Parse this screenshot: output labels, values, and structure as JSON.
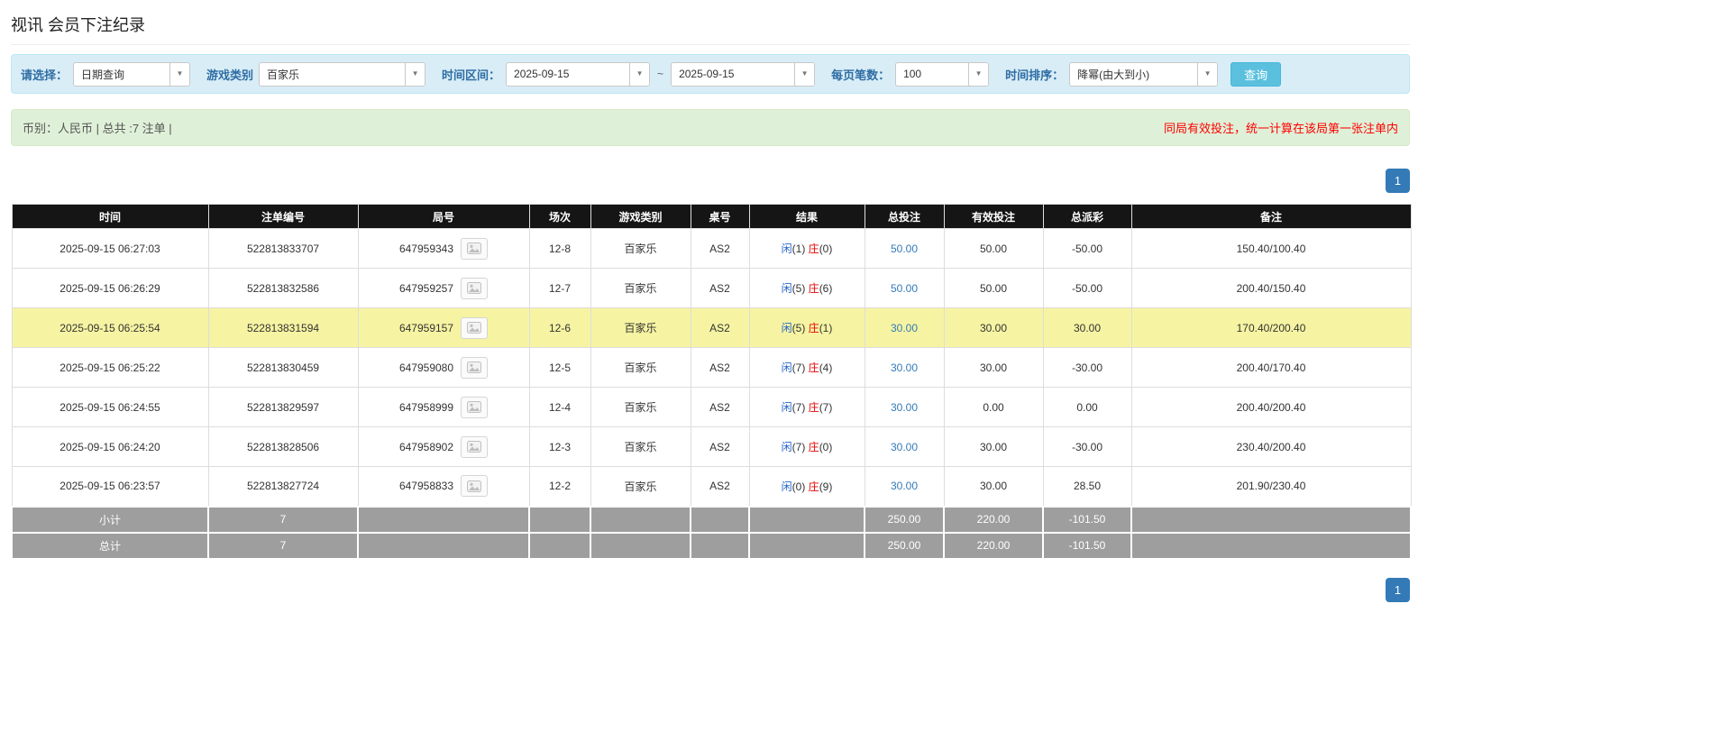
{
  "page": {
    "title": "视讯 会员下注纪录"
  },
  "colors": {
    "filter_bg": "#d9edf7",
    "filter_border": "#bce8f1",
    "filter_label": "#2e6da4",
    "search_button_bg": "#5bc0de",
    "summary_bg": "#dff0d8",
    "summary_border": "#d6e9c6",
    "warning_red": "#ff0000",
    "header_bg": "#151515",
    "highlight_row": "#f6f4a2",
    "link_blue": "#337ab7",
    "negative_red": "#f00000",
    "player_blue": "#2563c9",
    "banker_red": "#e60000",
    "pager_blue": "#337ab7",
    "footer_bg": "#9e9e9e",
    "footer_negative": "#c00000"
  },
  "filters": {
    "select_label": "请选择：",
    "select_value": "日期查询",
    "game_type_label": "游戏类别",
    "game_type_value": "百家乐",
    "date_range_label": "时间区间：",
    "date_from": "2025-09-15",
    "range_separator": "~",
    "date_to": "2025-09-15",
    "page_size_label": "每页笔数：",
    "page_size_value": "100",
    "sort_label": "时间排序：",
    "sort_value": "降幂(由大到小)",
    "search_button": "查询"
  },
  "summary": {
    "left": "币别：人民币 | 总共 :7 注单 |",
    "note": "同局有效投注，统一计算在该局第一张注单内"
  },
  "pagination": {
    "page": "1"
  },
  "table": {
    "headers": [
      "时间",
      "注单编号",
      "局号",
      "场次",
      "游戏类别",
      "桌号",
      "结果",
      "总投注",
      "有效投注",
      "总派彩",
      "备注"
    ],
    "rows": [
      {
        "time": "2025-09-15 06:27:03",
        "bet_id": "522813833707",
        "round_id": "647959343",
        "session": "12-8",
        "game_type": "百家乐",
        "table_no": "AS2",
        "player": "闲",
        "player_score": "(1)",
        "banker": "庄",
        "banker_score": "(0)",
        "total_bet": "50.00",
        "valid_bet": "50.00",
        "payout": "-50.00",
        "note": "150.40/100.40",
        "highlight": false
      },
      {
        "time": "2025-09-15 06:26:29",
        "bet_id": "522813832586",
        "round_id": "647959257",
        "session": "12-7",
        "game_type": "百家乐",
        "table_no": "AS2",
        "player": "闲",
        "player_score": "(5)",
        "banker": "庄",
        "banker_score": "(6)",
        "total_bet": "50.00",
        "valid_bet": "50.00",
        "payout": "-50.00",
        "note": "200.40/150.40",
        "highlight": false
      },
      {
        "time": "2025-09-15 06:25:54",
        "bet_id": "522813831594",
        "round_id": "647959157",
        "session": "12-6",
        "game_type": "百家乐",
        "table_no": "AS2",
        "player": "闲",
        "player_score": "(5)",
        "banker": "庄",
        "banker_score": "(1)",
        "total_bet": "30.00",
        "valid_bet": "30.00",
        "payout": "30.00",
        "note": "170.40/200.40",
        "highlight": true
      },
      {
        "time": "2025-09-15 06:25:22",
        "bet_id": "522813830459",
        "round_id": "647959080",
        "session": "12-5",
        "game_type": "百家乐",
        "table_no": "AS2",
        "player": "闲",
        "player_score": "(7)",
        "banker": "庄",
        "banker_score": "(4)",
        "total_bet": "30.00",
        "valid_bet": "30.00",
        "payout": "-30.00",
        "note": "200.40/170.40",
        "highlight": false
      },
      {
        "time": "2025-09-15 06:24:55",
        "bet_id": "522813829597",
        "round_id": "647958999",
        "session": "12-4",
        "game_type": "百家乐",
        "table_no": "AS2",
        "player": "闲",
        "player_score": "(7)",
        "banker": "庄",
        "banker_score": "(7)",
        "total_bet": "30.00",
        "valid_bet": "0.00",
        "payout": "0.00",
        "note": "200.40/200.40",
        "highlight": false
      },
      {
        "time": "2025-09-15 06:24:20",
        "bet_id": "522813828506",
        "round_id": "647958902",
        "session": "12-3",
        "game_type": "百家乐",
        "table_no": "AS2",
        "player": "闲",
        "player_score": "(7)",
        "banker": "庄",
        "banker_score": "(0)",
        "total_bet": "30.00",
        "valid_bet": "30.00",
        "payout": "-30.00",
        "note": "230.40/200.40",
        "highlight": false
      },
      {
        "time": "2025-09-15 06:23:57",
        "bet_id": "522813827724",
        "round_id": "647958833",
        "session": "12-2",
        "game_type": "百家乐",
        "table_no": "AS2",
        "player": "闲",
        "player_score": "(0)",
        "banker": "庄",
        "banker_score": "(9)",
        "total_bet": "30.00",
        "valid_bet": "30.00",
        "payout": "28.50",
        "note": "201.90/230.40",
        "highlight": false
      }
    ],
    "footer_rows": [
      {
        "label": "小计",
        "count": "7",
        "total_bet": "250.00",
        "valid_bet": "220.00",
        "payout": "-101.50"
      },
      {
        "label": "总计",
        "count": "7",
        "total_bet": "250.00",
        "valid_bet": "220.00",
        "payout": "-101.50"
      }
    ]
  }
}
